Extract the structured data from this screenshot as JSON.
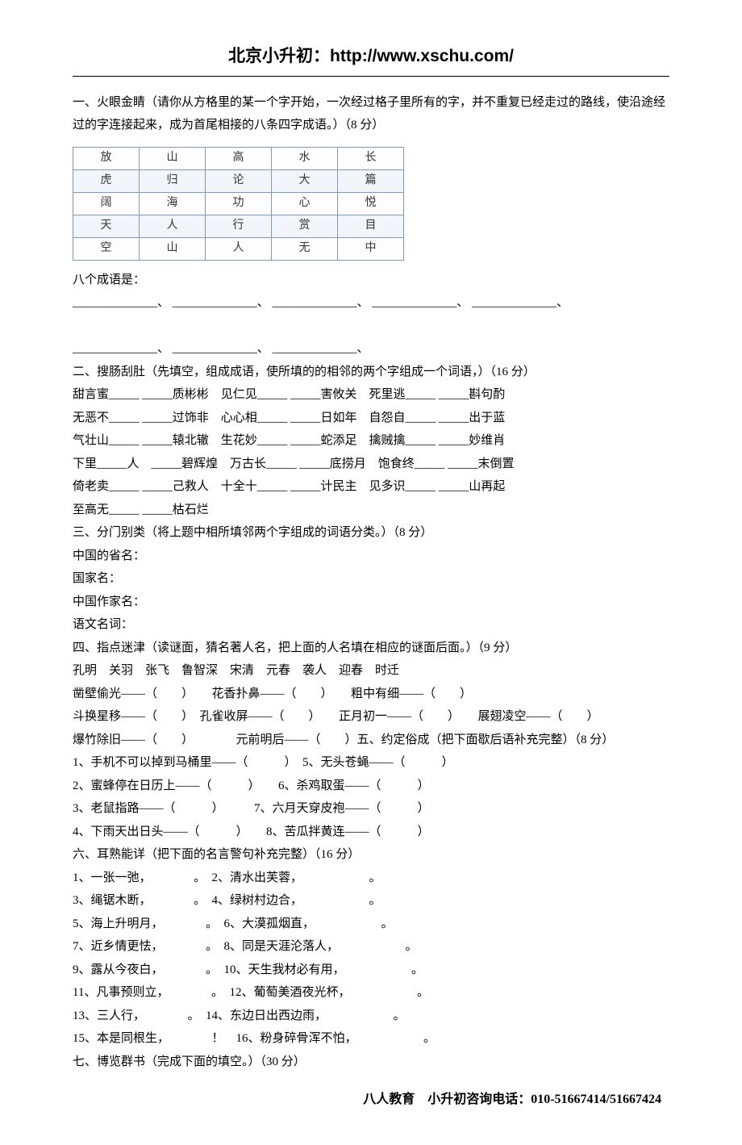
{
  "header": {
    "title_prefix": "北京小升初：",
    "url": "http://www.xschu.com/"
  },
  "q1": {
    "title": "一、火眼金睛（请你从方格里的某一个字开始，一次经过格子里所有的字，并不重复已经走过的路线，使沿途经过的字连接起来，成为首尾相接的八条四字成语。）（8 分）",
    "grid": [
      [
        "放",
        "山",
        "高",
        "水",
        "长"
      ],
      [
        "虎",
        "归",
        "论",
        "大",
        "篇"
      ],
      [
        "阔",
        "海",
        "功",
        "心",
        "悦"
      ],
      [
        "天",
        "人",
        "行",
        "赏",
        "目"
      ],
      [
        "空",
        "山",
        "人",
        "无",
        "中"
      ]
    ],
    "label": "八个成语是：",
    "blanks1": "______________、 ______________、 ______________、 ______________、 ______________、",
    "blanks2": "______________、 ______________、 ______________、"
  },
  "q2": {
    "title": "二、搜肠刮肚（先填空，组成成语，使所填的的相邻的两个字组成一个词语，）（16 分）",
    "l1": "甜言蜜_____  _____质彬彬　见仁见_____  _____害攸关　死里逃_____  _____斟句酌",
    "l2": "无恶不_____  _____过饰非　心心相_____  _____日如年　自怨自_____  _____出于蓝",
    "l3": "气壮山_____  _____辕北辙　生花妙_____  _____蛇添足　擒贼擒_____  _____妙维肖",
    "l4": "下里_____人　_____碧辉煌　万古长_____  _____底捞月　饱食终_____  _____末倒置",
    "l5": "倚老卖_____  _____己救人　十全十_____  _____计民主　见多识_____  _____山再起",
    "l6": "至高无_____  _____枯石烂"
  },
  "q3": {
    "title": "三、分门别类（将上题中相所填邻两个字组成的词语分类。）（8 分）",
    "l1": "中国的省名：",
    "l2": "国家名：",
    "l3": "中国作家名：",
    "l4": "语文名词："
  },
  "q4": {
    "title": "四、指点迷津（读谜面，猜名著人名，把上面的人名填在相应的谜面后面。）（9 分）",
    "names": "孔明　关羽　张飞　鲁智深　宋清　元春　袭人　迎春　时迁",
    "l1": "凿壁偷光——（　　）　　花香扑鼻——（　　）　　粗中有细——（　　）",
    "l2": "斗换星移——（　　）　孔雀收屏——（　　）　　正月初一——（　　）　　展翅凌空——（　　）",
    "l3": "爆竹除旧——（　　）　　　　元前明后——（　　）五、约定俗成（把下面歇后语补充完整）（8 分）",
    "l4": "1、手机不可以掉到马桶里——（　　　）　5、无头苍蝇——（　　　）",
    "l5": "2、蜜蜂停在日历上——（　　　）　　6、杀鸡取蛋——（　　　）",
    "l6": "3、老鼠指路——（　　　）　　　7、六月天穿皮袍——（　　　）",
    "l7": "4、下雨天出日头——（　　　）　　8、苦瓜拌黄连——（　　　）"
  },
  "q6": {
    "title": "六、耳熟能详（把下面的名言警句补充完整）（16 分）",
    "l1": "1、一张一弛，　　　　。　2、清水出芙蓉，　　　　　　。",
    "l2": "3、绳锯木断，　　　　。　4、绿树村边合，　　　　　　。",
    "l3": "5、海上升明月，　　　　。　6、大漠孤烟直，　　　　　　。",
    "l4": "7、近乡情更怯，　　　　。　8、同是天涯沦落人，　　　　　　。",
    "l5": "9、露从今夜白，　　　　。　10、天生我材必有用，　　　　　　。",
    "l6": "11、凡事预则立，　　　　。　12、葡萄美酒夜光杯，　　　　　　。",
    "l7": "13、三人行，　　　　。　14、东边日出西边雨，　　　　　　。",
    "l8": "15、本是同根生，　　　　！　16、粉身碎骨浑不怕，　　　　　　。"
  },
  "q7": {
    "title": "七、博览群书（完成下面的填空。）（30 分）"
  },
  "footer": {
    "text": "八人教育　小升初咨询电话：010-51667414/51667424"
  }
}
